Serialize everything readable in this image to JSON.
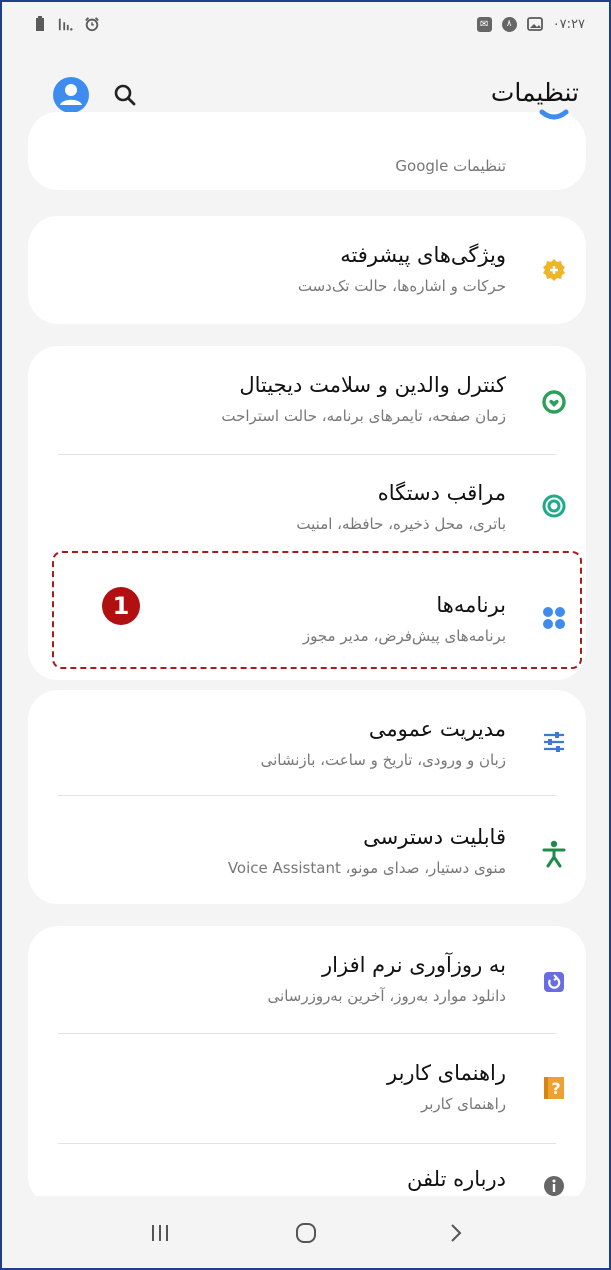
{
  "status_bar": {
    "time": "۰۷:۲۷",
    "right_icons": [
      "mail-icon",
      "number-badge-icon",
      "image-icon"
    ],
    "left_icons": [
      "battery-icon",
      "signal-icon",
      "alarm-icon"
    ],
    "badge_text": "۸"
  },
  "header": {
    "title": "تنظیمات",
    "accent": "#3e8cf0"
  },
  "cards": {
    "google": {
      "subtitle": "تنظیمات Google"
    },
    "advanced": {
      "title": "ویژگی‌های پیشرفته",
      "subtitle": "حرکات و اشاره‌ها، حالت تک‌دست",
      "icon": "gear-plus-icon",
      "icon_color": "#f0b429"
    },
    "parental": {
      "title": "کنترل والدین و سلامت دیجیتال",
      "subtitle": "زمان صفحه، تایمرهای برنامه، حالت استراحت",
      "icon": "digital-wellbeing-icon",
      "icon_color": "#2aa05a"
    },
    "device_care": {
      "title": "مراقب دستگاه",
      "subtitle": "باتری، محل ذخیره، حافظه، امنیت",
      "icon": "device-care-icon",
      "icon_color": "#1faa8a"
    },
    "apps": {
      "title": "برنامه‌ها",
      "subtitle": "برنامه‌های پیش‌فرض، مدیر مجوز",
      "icon": "apps-grid-icon",
      "icon_color": "#3e8cf0"
    },
    "general": {
      "title": "مدیریت عمومی",
      "subtitle": "زبان و ورودی، تاریخ و ساعت، بازنشانی",
      "icon": "sliders-icon",
      "icon_color": "#3c7bd1"
    },
    "accessibility": {
      "title": "قابلیت دسترسی",
      "subtitle": "منوی دستیار، صدای مونو، Voice Assistant",
      "icon": "accessibility-person-icon",
      "icon_color": "#1f8a4a"
    },
    "update": {
      "title": "به روزآوری نرم افزار",
      "subtitle": "دانلود موارد به‌روز، آخرین به‌روزرسانی",
      "icon": "update-icon",
      "icon_color": "#6a6de0"
    },
    "manual": {
      "title": "راهنمای کاربر",
      "subtitle": "راهنمای کاربر",
      "icon": "help-book-icon",
      "icon_color": "#f0a030"
    },
    "about": {
      "title": "درباره تلفن",
      "icon": "info-icon",
      "icon_color": "#666666"
    }
  },
  "annotation": {
    "marker": "1",
    "color": "#b01010"
  },
  "navbar": {
    "buttons": [
      "recents-icon",
      "home-icon",
      "back-icon"
    ]
  }
}
